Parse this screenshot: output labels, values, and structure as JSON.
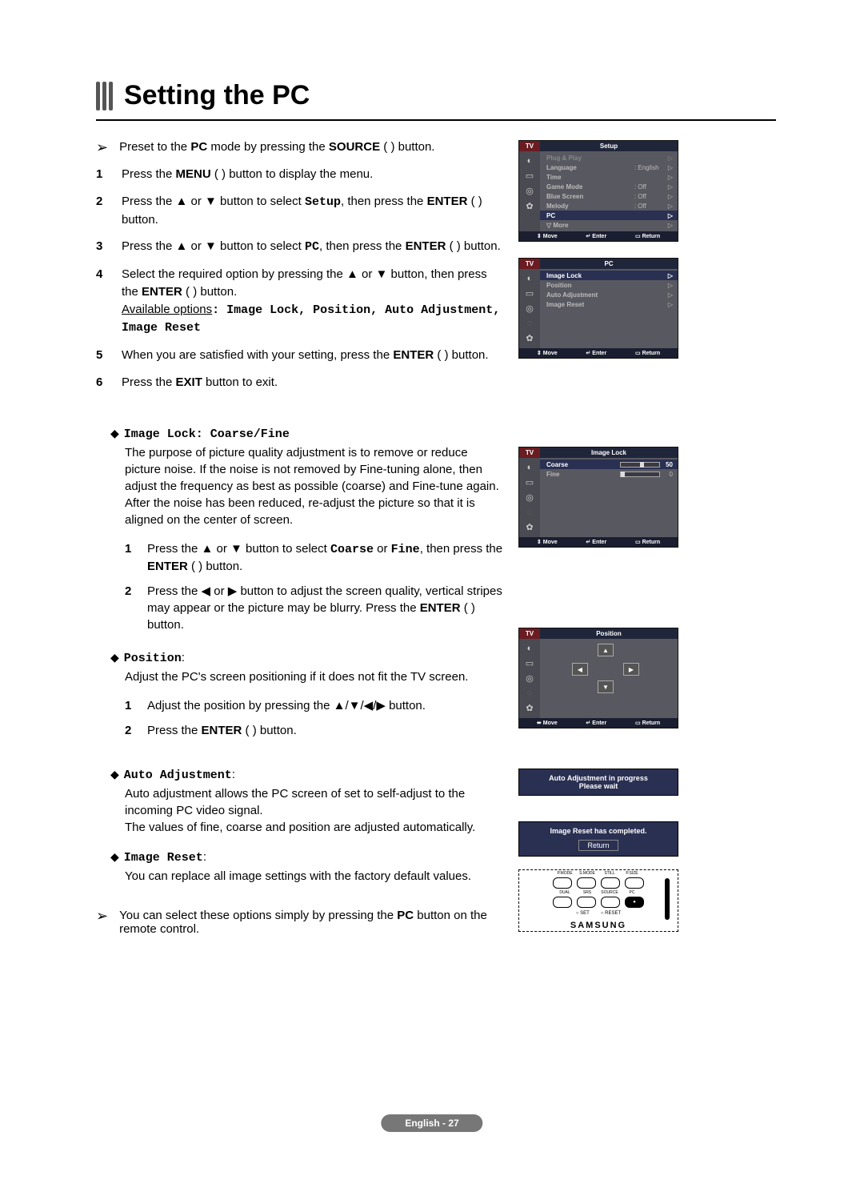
{
  "title": "Setting the PC",
  "intro_pre": "Preset to the ",
  "intro_pc": "PC",
  "intro_mid": " mode by pressing the ",
  "intro_src": "SOURCE",
  "intro_end": " (    ) button.",
  "steps": [
    {
      "n": "1",
      "a": "Press the ",
      "b": "MENU",
      "c": " (    ) button to display the menu."
    },
    {
      "n": "2",
      "a": "Press the ▲ or ▼ button to select ",
      "m": "Setup",
      "c": ", then press the ",
      "b": "ENTER",
      "d": " (    ) button."
    },
    {
      "n": "3",
      "a": "Press the ▲ or ▼ button to select ",
      "m": "PC",
      "c": ", then press the ",
      "b": "ENTER",
      "d": " (    ) button."
    },
    {
      "n": "4",
      "a": "Select the required option by pressing the ▲ or ▼ button, then press the ",
      "b": "ENTER",
      "d": " (    ) button."
    },
    {
      "n": "5",
      "a": "When you are satisfied with your setting, press the ",
      "b": "ENTER",
      "d": " (    ) button."
    },
    {
      "n": "6",
      "a": "Press the ",
      "b": "EXIT",
      "d": " button to exit."
    }
  ],
  "avail_label": "Available options",
  "avail_opts": ": Image Lock, Position, Auto Adjustment, Image Reset",
  "imlock": {
    "head": "Image Lock: Coarse/Fine",
    "desc": "The purpose of picture quality adjustment is to remove or reduce picture noise. If the noise is not removed by Fine-tuning alone, then adjust the frequency as best as possible (coarse) and Fine-tune again.\nAfter the noise has been reduced, re-adjust the picture so that it is aligned on the center of screen.",
    "s1a": "Press the ▲ or ▼ button to select ",
    "s1m1": "Coarse",
    "s1mid": " or ",
    "s1m2": "Fine",
    "s1c": ", then press the ",
    "s1b": "ENTER",
    "s1d": " (    ) button.",
    "s2a": "Press the ◀ or ▶ button to adjust the screen quality, vertical stripes may appear or the picture may be blurry. Press the ",
    "s2b": "ENTER",
    "s2d": " (    ) button."
  },
  "position": {
    "head": "Position",
    "desc": "Adjust the PC's screen positioning if it does not fit the TV screen.",
    "s1": "Adjust the position by pressing the ▲/▼/◀/▶ button.",
    "s2a": "Press the ",
    "s2b": "ENTER",
    "s2d": " (    ) button."
  },
  "auto": {
    "head": "Auto Adjustment",
    "desc": "Auto adjustment allows the PC screen of set to self-adjust to the incoming PC video signal.\nThe values of fine, coarse and position are adjusted automatically."
  },
  "reset": {
    "head": "Image Reset",
    "desc": "You can replace all image settings with the factory default values."
  },
  "tip_a": "You can select these options simply by pressing the ",
  "tip_b": "PC",
  "tip_c": " button on the remote control.",
  "page_num": "English - 27",
  "osd": {
    "tv": "TV",
    "setup": "Setup",
    "setup_rows": [
      {
        "l": "Plug & Play",
        "v": "",
        "dim": true
      },
      {
        "l": "Language",
        "v": ": English"
      },
      {
        "l": "Time",
        "v": ""
      },
      {
        "l": "Game Mode",
        "v": ": Off"
      },
      {
        "l": "Blue Screen",
        "v": ": Off"
      },
      {
        "l": "Melody",
        "v": ": Off"
      },
      {
        "l": "PC",
        "v": "",
        "sel": true
      },
      {
        "l": "▽ More",
        "v": ""
      }
    ],
    "pc": "PC",
    "pc_rows": [
      {
        "l": "Image Lock",
        "sel": true
      },
      {
        "l": "Position"
      },
      {
        "l": "Auto Adjustment"
      },
      {
        "l": "Image Reset"
      }
    ],
    "imlock": "Image Lock",
    "coarse": "Coarse",
    "coarse_v": "50",
    "fine": "Fine",
    "fine_v": "0",
    "position": "Position",
    "foot": {
      "move": "Move",
      "enter": "Enter",
      "return": "Return"
    },
    "automsg": "Auto Adjustment in progress\nPlease wait",
    "resetmsg": "Image Reset has completed.",
    "returnbtn": "Return",
    "remote": {
      "row1": [
        "P.MODE",
        "S.MODE",
        "STILL",
        "P.SIZE"
      ],
      "row2": [
        "DUAL",
        "SRS",
        "SOURCE",
        "PC"
      ],
      "row3": [
        "SET",
        "RESET"
      ],
      "brand": "SAMSUNG"
    }
  }
}
